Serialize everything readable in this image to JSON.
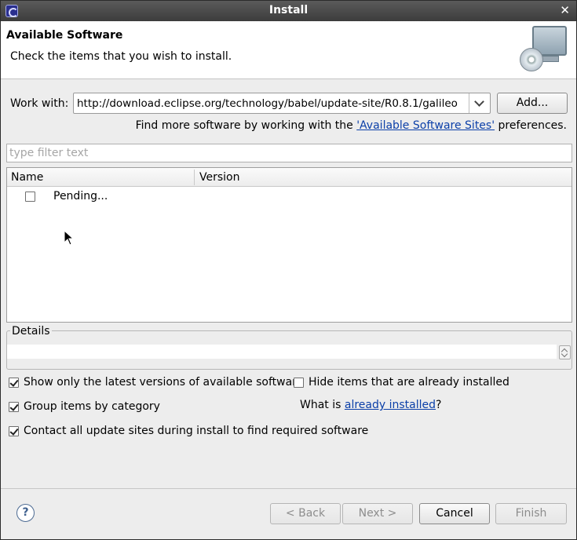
{
  "window": {
    "title": "Install",
    "app_icon": "eclipse-icon",
    "close_icon": "close-icon"
  },
  "header": {
    "title": "Available Software",
    "description": "Check the items that you wish to install.",
    "banner_icon": "install-software-banner-icon"
  },
  "work_with": {
    "label": "Work with:",
    "value": "http://download.eclipse.org/technology/babel/update-site/R0.8.1/galileo",
    "add_label": "Add..."
  },
  "find_more": {
    "prefix": "Find more software by working with the ",
    "link": "'Available Software Sites'",
    "suffix": " preferences."
  },
  "filter": {
    "placeholder": "type filter text"
  },
  "table": {
    "columns": [
      "Name",
      "Version"
    ],
    "rows": [
      {
        "name": "Pending...",
        "version": "",
        "checked": false
      }
    ]
  },
  "details": {
    "title": "Details"
  },
  "options": {
    "show_latest": {
      "label": "Show only the latest versions of available software",
      "checked": true
    },
    "hide_installed": {
      "label": "Hide items that are already installed",
      "checked": false
    },
    "group_by_category": {
      "label": "Group items by category",
      "checked": true
    },
    "contact_all_sites": {
      "label": "Contact all update sites during install to find required software",
      "checked": true
    },
    "what_is": {
      "prefix": "What is ",
      "link": "already installed",
      "suffix": "?"
    }
  },
  "footer": {
    "help_icon": "help-icon",
    "back_label": "< Back",
    "next_label": "Next >",
    "cancel_label": "Cancel",
    "finish_label": "Finish"
  }
}
